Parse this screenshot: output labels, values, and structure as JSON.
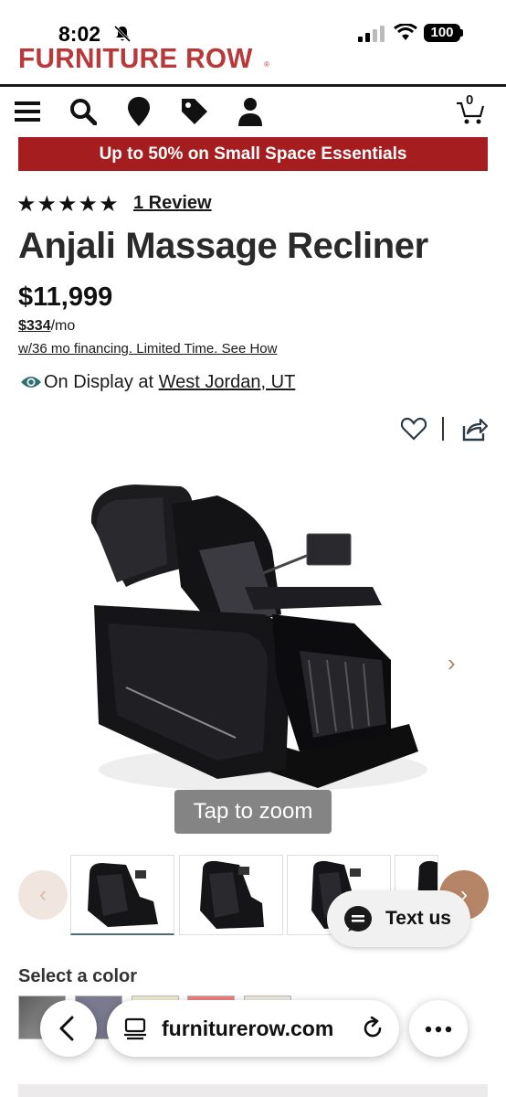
{
  "status_bar": {
    "time": "8:02",
    "battery": "100"
  },
  "header": {
    "brand": "FURNITURE ROW",
    "brand_mark": "®",
    "cart_count": "0",
    "nav_icons": [
      "menu-icon",
      "search-icon",
      "location-pin-icon",
      "tag-icon",
      "account-icon",
      "cart-icon"
    ]
  },
  "promo": {
    "text": "Up to 50% on Small Space Essentials",
    "bg_color": "#a51d1f"
  },
  "product": {
    "rating_stars": "★★★★★",
    "rating_value": 5,
    "reviews_link": "1 Review",
    "title": "Anjali Massage Recliner",
    "price": "$11,999",
    "monthly_amount": "$334",
    "monthly_suffix": "/mo",
    "financing": "w/36 mo financing. Limited Time. See How",
    "display_prefix": "On Display at",
    "display_location": "West Jordan, UT"
  },
  "gallery": {
    "zoom_label": "Tap to zoom",
    "next_arrow": "›",
    "prev_button": "‹",
    "next_button": "›",
    "thumbnails_count": 4,
    "selected_thumbnail": 1
  },
  "chat": {
    "label": "Text us"
  },
  "colors": {
    "label": "Select a color",
    "swatches": [
      "#7b7b7b",
      "#7a7a8f",
      "#f3eed2",
      "#f07f7f",
      "#eeece2"
    ]
  },
  "browser": {
    "url": "furniturerow.com"
  },
  "theme": {
    "accent": "#b7393a",
    "nav_button": "#b68567",
    "eye_icon": "#2f6f6f"
  }
}
